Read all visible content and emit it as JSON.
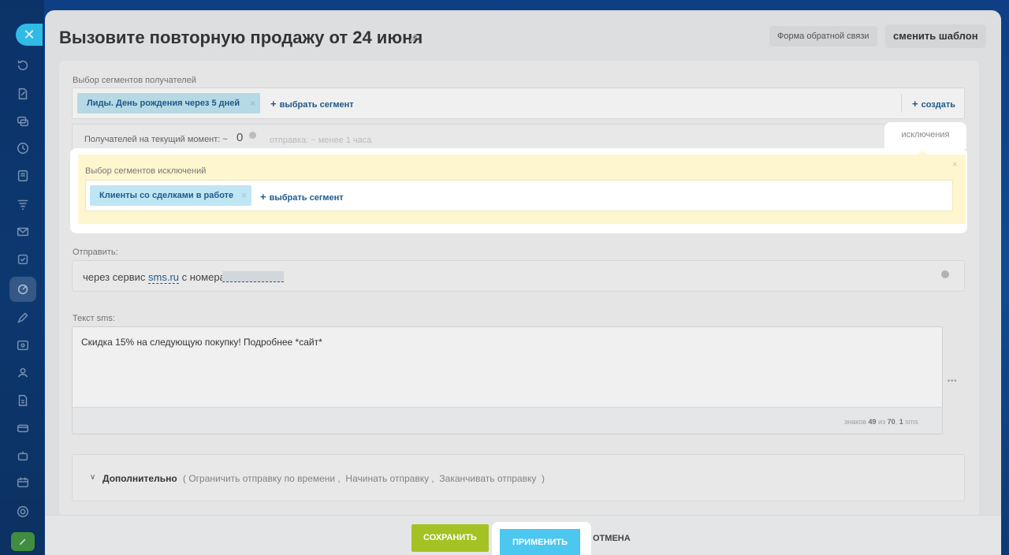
{
  "window": {
    "close_icon": "close-icon"
  },
  "header": {
    "title": "Вызовите повторную продажу от 24 июня",
    "feedback_button": "Форма обратной связи",
    "template_button": "сменить шаблон"
  },
  "recipients": {
    "label": "Выбор сегментов получателей",
    "segment_tag": "Лиды. День рождения через 5 дней",
    "add_segment": "выбрать сегмент",
    "create": "создать",
    "count_label": "Получателей на текущий момент: ~",
    "count_value": "0",
    "send_time": "отправка: ~ менее 1 часа",
    "exclusions_tab": "исключения"
  },
  "exclusions": {
    "label": "Выбор сегментов исключений",
    "segment_tag": "Клиенты со сделками в работе",
    "add_segment": "выбрать сегмент"
  },
  "send": {
    "label": "Отправить:",
    "text_before": "через сервис",
    "service_link": "sms.ru",
    "text_after": "с номера"
  },
  "sms": {
    "label": "Текст sms:",
    "text": "Скидка 15% на следующую покупку! Подробнее *сайт*",
    "counter_prefix": "знаков",
    "chars": "49",
    "counter_of": "из",
    "max_chars": "70",
    "sms_count": "1",
    "sms_unit": "sms",
    "more_button": "•••"
  },
  "additional": {
    "title": "Дополнительно",
    "options": "( Ограничить отправку по времени ,  Начинать отправку ,  Заканчивать отправку  )"
  },
  "footer": {
    "save": "СОХРАНИТЬ",
    "apply": "ПРИМЕНИТЬ",
    "cancel": "ОТМЕНА"
  }
}
